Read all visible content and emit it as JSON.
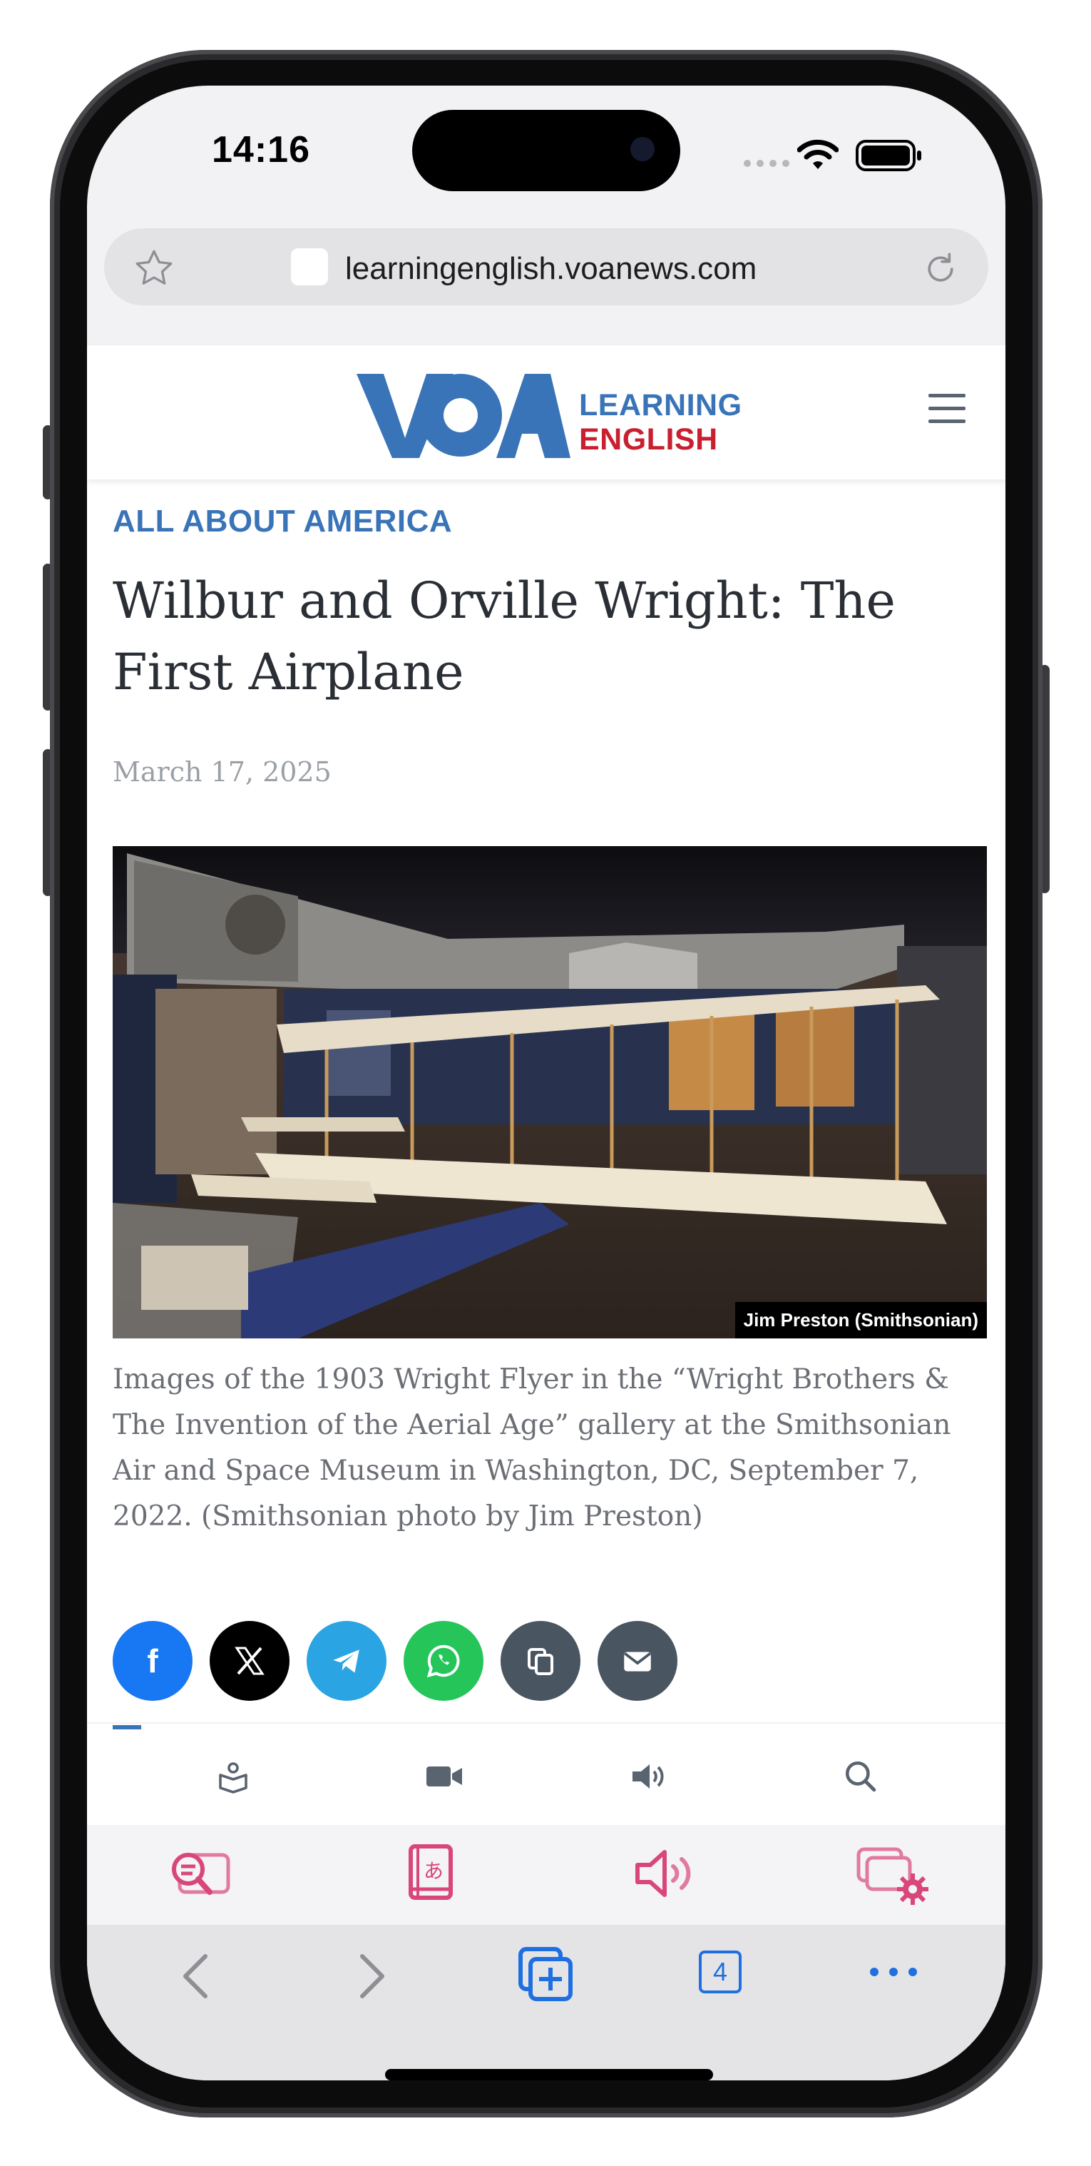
{
  "status_bar": {
    "time": "14:16"
  },
  "browser": {
    "url": "learningenglish.voanews.com"
  },
  "site": {
    "logo_voa": "VOA",
    "logo_line1": "LEARNING",
    "logo_line2": "ENGLISH"
  },
  "article": {
    "kicker": "ALL ABOUT AMERICA",
    "headline": "Wilbur and Orville Wright: The First Airplane",
    "date": "March 17, 2025",
    "photo_credit": "Jim Preston (Smithsonian)",
    "caption": "Images of the 1903 Wright Flyer in the “Wright Brothers & The Invention of the Aerial Age” gallery at the Smithsonian Air and Space Museum in Washington, DC, September 7, 2022. (Smithsonian photo by Jim Preston)"
  },
  "share_buttons": [
    {
      "name": "facebook-share-button",
      "icon": "facebook-icon",
      "color": "#1877f2"
    },
    {
      "name": "x-share-button",
      "icon": "x-icon",
      "color": "#000000"
    },
    {
      "name": "telegram-share-button",
      "icon": "telegram-icon",
      "color": "#2aa4e2"
    },
    {
      "name": "whatsapp-share-button",
      "icon": "whatsapp-icon",
      "color": "#25c55a"
    },
    {
      "name": "copy-link-button",
      "icon": "copy-icon",
      "color": "#495560"
    },
    {
      "name": "email-share-button",
      "icon": "mail-icon",
      "color": "#495560"
    }
  ],
  "site_nav": [
    "book-reader-icon",
    "video-icon",
    "speaker-icon",
    "search-icon"
  ],
  "extension_bar": [
    "translate-search-icon",
    "dictionary-icon",
    "read-aloud-icon",
    "extension-settings-icon"
  ],
  "browser_toolbar": {
    "tab_count": "4",
    "icons": [
      "back-icon",
      "forward-icon",
      "new-tab-icon",
      "tabs-icon",
      "more-icon"
    ]
  },
  "colors": {
    "voa_blue": "#3a74b8",
    "voa_red": "#c8202e",
    "extension_pink": "#d9477a",
    "toolbar_blue": "#1f6fe0"
  }
}
